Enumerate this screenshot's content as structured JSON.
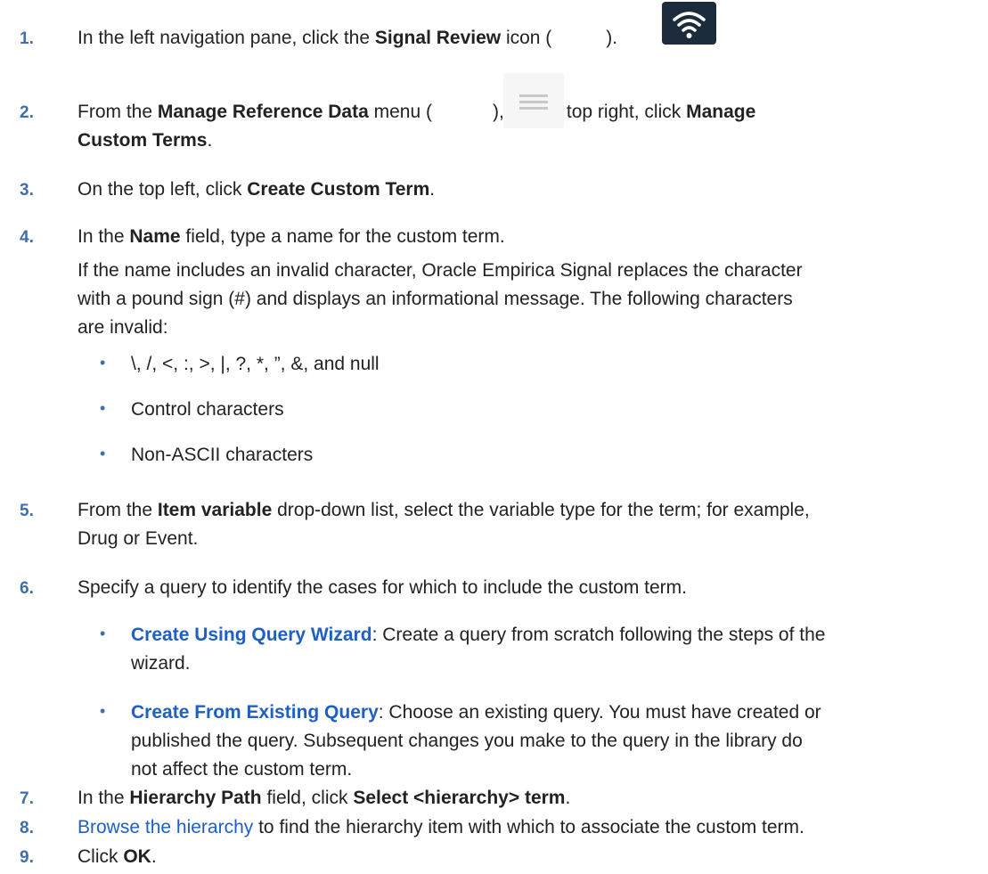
{
  "steps": [
    {
      "num": "1.",
      "parts": [
        "In the left navigation pane, click the ",
        "Signal Review",
        " icon (",
        ")."
      ]
    },
    {
      "num": "2.",
      "parts": [
        "From the ",
        "Manage Reference Data",
        " menu (",
        "), on the top right, click ",
        "Manage",
        "Custom Terms",
        "."
      ]
    },
    {
      "num": "3.",
      "parts": [
        "On the top left, click ",
        "Create Custom Term",
        "."
      ]
    },
    {
      "num": "4.",
      "parts": [
        "In the ",
        "Name",
        " field, type a name for the custom term."
      ],
      "para": [
        "If the name includes an invalid character, Oracle Empirica Signal replaces the character",
        "with a pound sign (#) and displays an informational message. The following characters",
        "are invalid:"
      ],
      "bullets": [
        "\\, /, <, :, >, |, ?, *, ”, &, and null",
        "Control characters",
        "Non-ASCII characters"
      ]
    },
    {
      "num": "5.",
      "parts": [
        "From the ",
        "Item variable",
        " drop-down list, select the variable type for the term; for example,",
        "Drug or Event."
      ]
    },
    {
      "num": "6.",
      "parts": [
        "Specify a query to identify the cases for which to include the custom term."
      ],
      "sub": [
        {
          "bullet": "•",
          "link": "Create Using Query Wizard",
          "lines": [
            ": Create a query from scratch following the steps of the",
            "wizard."
          ]
        },
        {
          "bullet": "•",
          "link": "Create From Existing Query",
          "lines": [
            ": Choose an existing query. You must have created or",
            "published the query. Subsequent changes you make to the query in the library do",
            "not affect the custom term."
          ]
        }
      ]
    },
    {
      "num": "7.",
      "parts": [
        "In the ",
        "Hierarchy Path",
        " field, click ",
        "Select <hierarchy> term",
        "."
      ]
    },
    {
      "num": "8.",
      "link": "Browse the hierarchy",
      "parts": [
        " to find the hierarchy item with which to associate the custom term."
      ]
    },
    {
      "num": "9.",
      "parts": [
        "Click ",
        "OK",
        "."
      ]
    }
  ],
  "bullet_char": "•",
  "icons": {
    "step1": "signal-review-wifi-icon",
    "step2": "manage-reference-data-menu-icon"
  },
  "colors": {
    "number": "#3f6fa8",
    "link": "#1f5fc4",
    "text": "#222222",
    "icon_bg": "#1d2c3c"
  }
}
